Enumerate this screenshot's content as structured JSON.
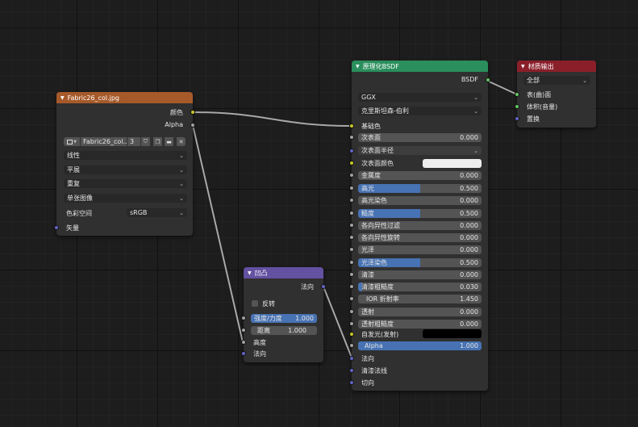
{
  "colors": {
    "image_header": "#a65a2a",
    "bump_header": "#6351a1",
    "bsdf_header": "#2a8f5c",
    "output_header": "#8a1f2a",
    "socket_color": "#c7c729",
    "socket_float": "#a1a1a1",
    "socket_vector": "#6363c7",
    "socket_shader": "#63c763",
    "field_fill": "#4772b3"
  },
  "image_node": {
    "title": "Fabric26_col.jpg",
    "out_color": "颜色",
    "out_alpha": "Alpha",
    "image_name": "Fabric26_col...",
    "users": "3",
    "interpolation": "线性",
    "projection": "平展",
    "extension": "重复",
    "source": "单张图像",
    "colorspace_label": "色彩空间",
    "colorspace_value": "sRGB",
    "in_vector": "矢量"
  },
  "bump_node": {
    "title": "凹凸",
    "out_normal": "法向",
    "invert_label": "反转",
    "strength_label": "强度/力度",
    "strength_value": "1.000",
    "distance_label": "距离",
    "distance_value": "1.000",
    "height_label": "高度",
    "normal_label": "法向"
  },
  "bsdf_node": {
    "title": "原理化BSDF",
    "out_bsdf": "BSDF",
    "distribution": "GGX",
    "subsurface_method": "克里斯坦森-伯利",
    "base_color": "基础色",
    "fields": [
      {
        "label": "次表面",
        "value": "0.000",
        "fill": 0
      },
      {
        "label": "金属度",
        "value": "0.000",
        "fill": 0
      },
      {
        "label": "高光",
        "value": "0.500",
        "fill": 0.5
      },
      {
        "label": "高光染色",
        "value": "0.000",
        "fill": 0
      },
      {
        "label": "糙度",
        "value": "0.500",
        "fill": 0.5
      },
      {
        "label": "各向异性过滤",
        "value": "0.000",
        "fill": 0
      },
      {
        "label": "各向异性旋转",
        "value": "0.000",
        "fill": 0
      },
      {
        "label": "光泽",
        "value": "0.000",
        "fill": 0
      },
      {
        "label": "光泽染色",
        "value": "0.500",
        "fill": 0.5
      },
      {
        "label": "清漆",
        "value": "0.000",
        "fill": 0
      },
      {
        "label": "清漆粗糙度",
        "value": "0.030",
        "fill": 0.03
      },
      {
        "label": "IOR 折射率",
        "value": "1.450",
        "fill": 0
      },
      {
        "label": "透射",
        "value": "0.000",
        "fill": 0
      },
      {
        "label": "透射粗糙度",
        "value": "0.000",
        "fill": 0
      },
      {
        "label": "Alpha",
        "value": "1.000",
        "fill": 1
      }
    ],
    "subsurface_radius": "次表面半径",
    "subsurface_color": "次表面颜色",
    "emission": "自发光(发射)",
    "normal": "法向",
    "clearcoat_normal": "清漆法线",
    "tangent": "切向"
  },
  "output_node": {
    "title": "材质输出",
    "target": "全部",
    "surface": "表(曲)面",
    "volume": "体积(音量)",
    "displacement": "置换"
  }
}
